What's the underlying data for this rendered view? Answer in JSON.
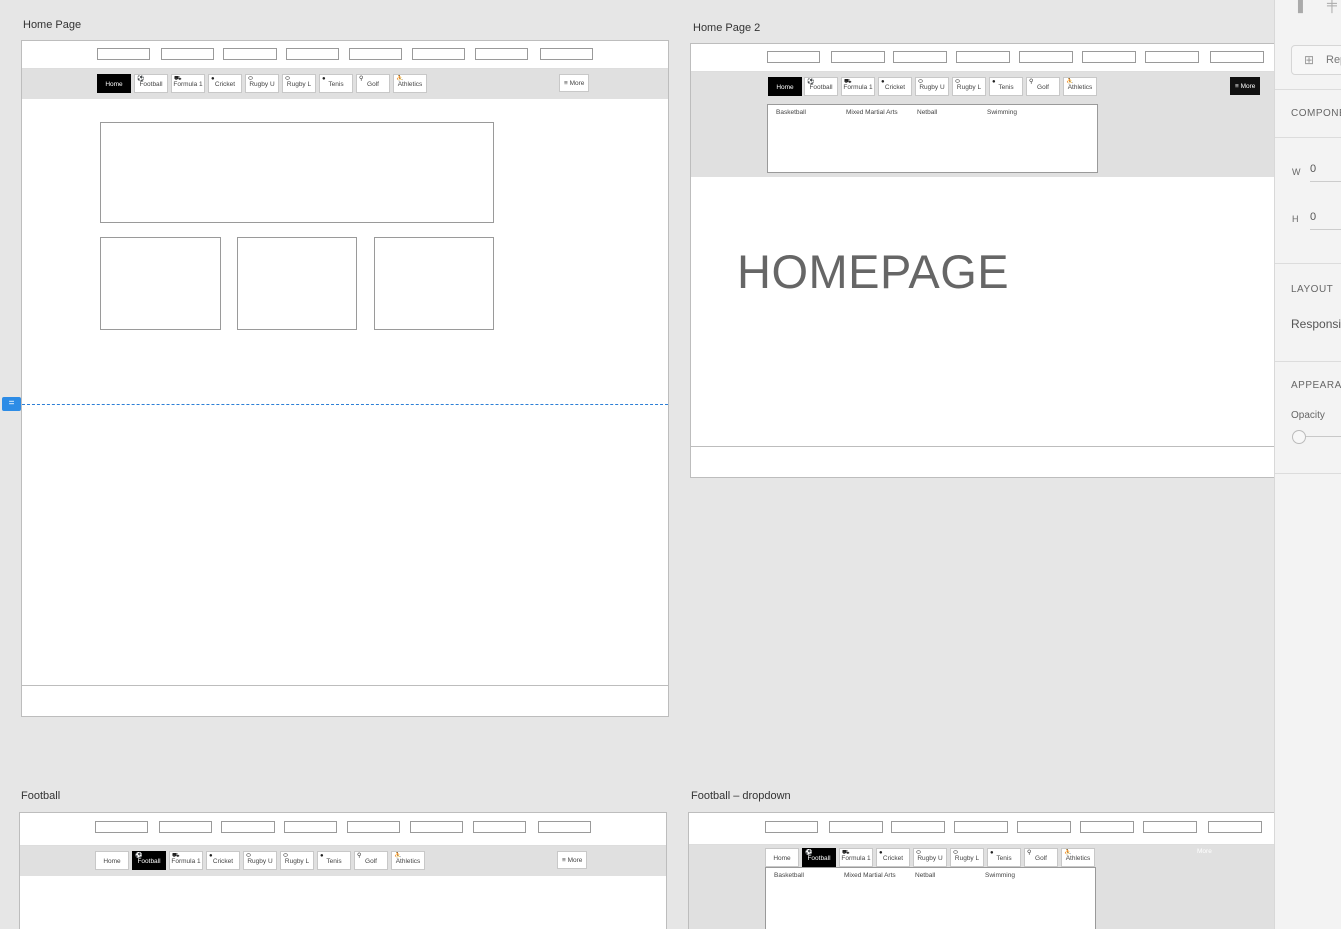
{
  "artboards": {
    "home_page": {
      "label": "Home Page"
    },
    "home_page_2": {
      "label": "Home Page 2",
      "hero_text": "HOMEPAGE"
    },
    "football": {
      "label": "Football"
    },
    "football_dropdown": {
      "label": "Football – dropdown"
    }
  },
  "nav": {
    "home": "Home",
    "football": "Football",
    "formula1": "Formula 1",
    "cricket": "Cricket",
    "rugby_u": "Rugby U",
    "rugby_l": "Rugby L",
    "tenis": "Tenis",
    "golf": "Golf",
    "athletics": "Athletics",
    "more": "≡ More",
    "more_plain": "More"
  },
  "dropdown": {
    "items": [
      "Basketball",
      "Mixed Martial Arts",
      "Netball",
      "Swimming"
    ]
  },
  "panel": {
    "repeat_label": "Rep",
    "components_head": "COMPONENT",
    "w_label": "W",
    "w_value": "0",
    "h_label": "H",
    "h_value": "0",
    "layout_head": "LAYOUT",
    "layout_value": "Responsive",
    "appearance_head": "APPEARANCE",
    "opacity_label": "Opacity"
  },
  "colors": {
    "canvas": "#e6e6e6",
    "active_tab": "#000000",
    "guide": "#2d7fd6"
  },
  "icons": [
    "football-icon",
    "car-icon",
    "cricket-ball-icon",
    "rugby-ball-icon",
    "tennis-ball-icon",
    "golf-icon",
    "runner-icon",
    "menu-icon",
    "grid-icon"
  ]
}
